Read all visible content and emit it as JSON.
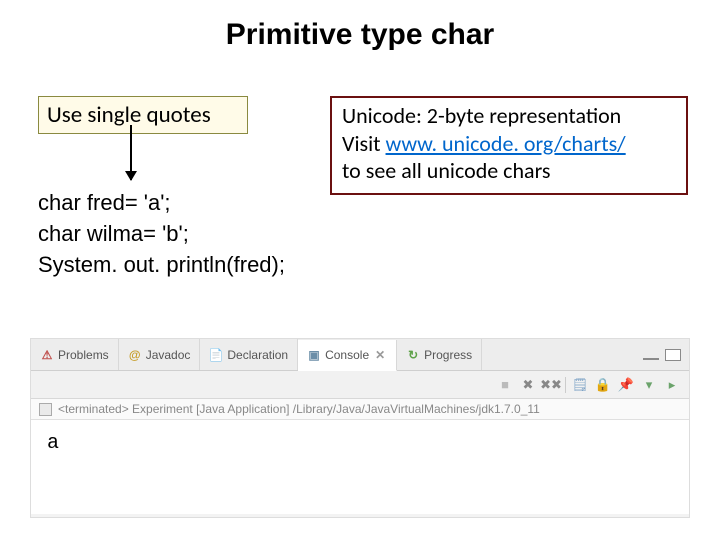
{
  "title": "Primitive type char",
  "quotes_box": "Use single quotes",
  "unicode_box": {
    "line1": "Unicode: 2-byte representation",
    "line2_pre": "Visit  ",
    "link": "www. unicode. org/charts/",
    "line3": "to see all unicode chars"
  },
  "code": {
    "line1": "char fred= 'a';",
    "line2": "char wilma= 'b';",
    "line3": "System. out. println(fred);"
  },
  "ide": {
    "tabs": {
      "problems": "Problems",
      "javadoc": "Javadoc",
      "declaration": "Declaration",
      "console": "Console",
      "progress": "Progress"
    },
    "status": "<terminated> Experiment [Java Application] /Library/Java/JavaVirtualMachines/jdk1.7.0_11",
    "output": "a"
  }
}
